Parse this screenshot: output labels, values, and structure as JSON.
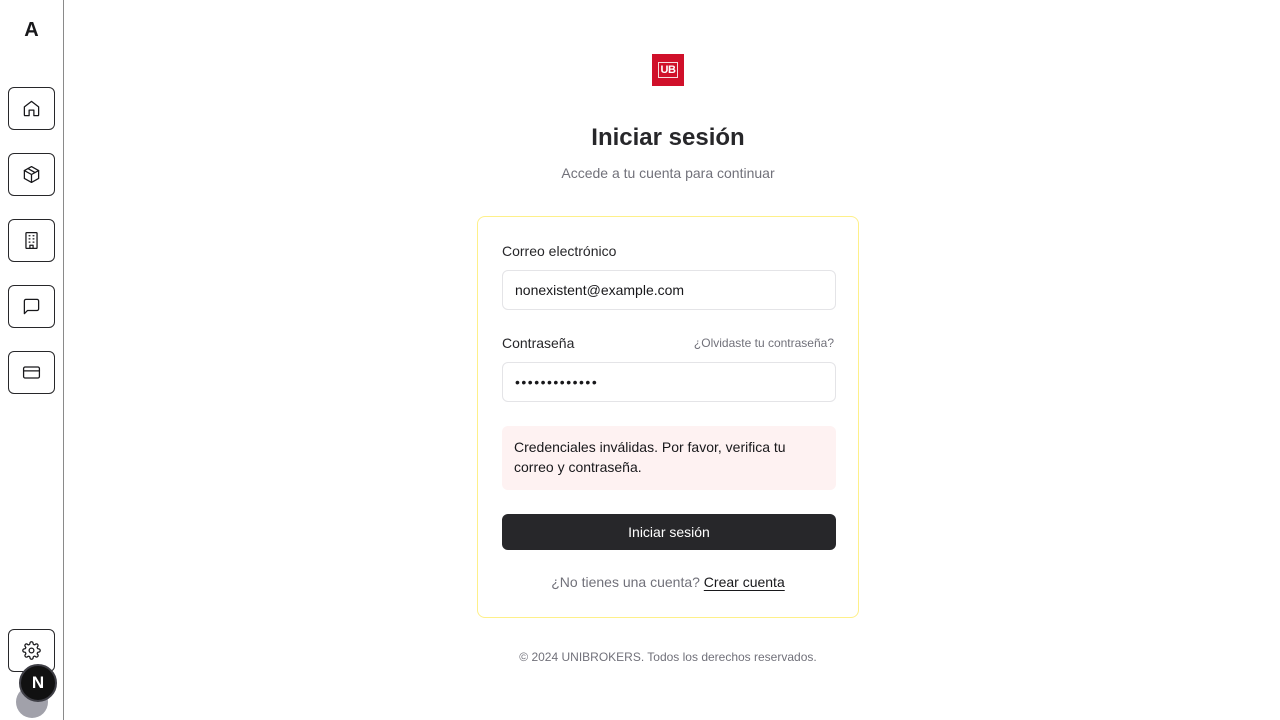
{
  "sidebar": {
    "brand": "A",
    "items": [
      {
        "icon": "home-icon"
      },
      {
        "icon": "package-icon"
      },
      {
        "icon": "building-icon"
      },
      {
        "icon": "message-icon"
      },
      {
        "icon": "credit-card-icon"
      }
    ],
    "settings_icon": "gear-icon",
    "badge": "N"
  },
  "logo": {
    "text": "UB",
    "color": "#d0102a"
  },
  "header": {
    "title": "Iniciar sesión",
    "subtitle": "Accede a tu cuenta para continuar"
  },
  "form": {
    "email_label": "Correo electrónico",
    "email_value": "nonexistent@example.com",
    "password_label": "Contraseña",
    "forgot_link": "¿Olvidaste tu contraseña?",
    "password_value": "•••••••••••••",
    "error_message": "Credenciales inválidas. Por favor, verifica tu correo y contraseña.",
    "submit_label": "Iniciar sesión",
    "signup_prompt": "¿No tienes una cuenta?",
    "signup_link": "Crear cuenta"
  },
  "footer": {
    "copyright": "© 2024 UNIBROKERS. Todos los derechos reservados."
  },
  "colors": {
    "accent": "#27272a",
    "card_border": "#fef08a",
    "error_bg": "#fef2f2"
  }
}
